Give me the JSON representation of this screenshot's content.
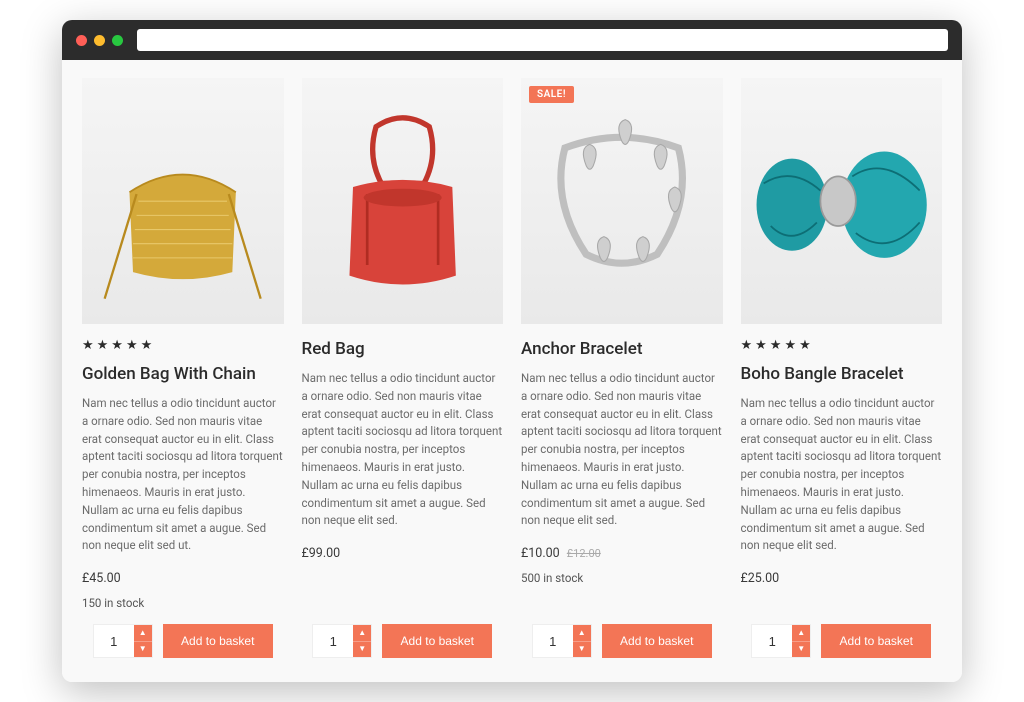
{
  "colors": {
    "accent": "#f37556"
  },
  "sale_label": "SALE!",
  "add_to_basket_label": "Add to basket",
  "default_qty": "1",
  "products": [
    {
      "title": "Golden Bag With Chain",
      "rating": 5,
      "description": "Nam nec tellus a odio tincidunt auctor a ornare odio. Sed non mauris vitae erat consequat auctor eu in elit. Class aptent taciti sociosqu ad litora torquent per conubia nostra, per inceptos himenaeos. Mauris in erat justo. Nullam ac urna eu felis dapibus condimentum sit amet a augue. Sed non neque elit sed ut.",
      "price": "£45.00",
      "old_price": "",
      "stock": "150 in stock",
      "sale": false
    },
    {
      "title": "Red Bag",
      "rating": 0,
      "description": "Nam nec tellus a odio tincidunt auctor a ornare odio. Sed non mauris vitae erat consequat auctor eu in elit. Class aptent taciti sociosqu ad litora torquent per conubia nostra, per inceptos himenaeos. Mauris in erat justo. Nullam ac urna eu felis dapibus condimentum sit amet a augue. Sed non neque elit sed.",
      "price": "£99.00",
      "old_price": "",
      "stock": "",
      "sale": false
    },
    {
      "title": "Anchor Bracelet",
      "rating": 0,
      "description": "Nam nec tellus a odio tincidunt auctor a ornare odio. Sed non mauris vitae erat consequat auctor eu in elit. Class aptent taciti sociosqu ad litora torquent per conubia nostra, per inceptos himenaeos. Mauris in erat justo. Nullam ac urna eu felis dapibus condimentum sit amet a augue. Sed non neque elit sed.",
      "price": "£10.00",
      "old_price": "£12.00",
      "stock": "500 in stock",
      "sale": true
    },
    {
      "title": "Boho Bangle Bracelet",
      "rating": 5,
      "description": "Nam nec tellus a odio tincidunt auctor a ornare odio. Sed non mauris vitae erat consequat auctor eu in elit. Class aptent taciti sociosqu ad litora torquent per conubia nostra, per inceptos himenaeos. Mauris in erat justo. Nullam ac urna eu felis dapibus condimentum sit amet a augue. Sed non neque elit sed.",
      "price": "£25.00",
      "old_price": "",
      "stock": "",
      "sale": false
    }
  ]
}
